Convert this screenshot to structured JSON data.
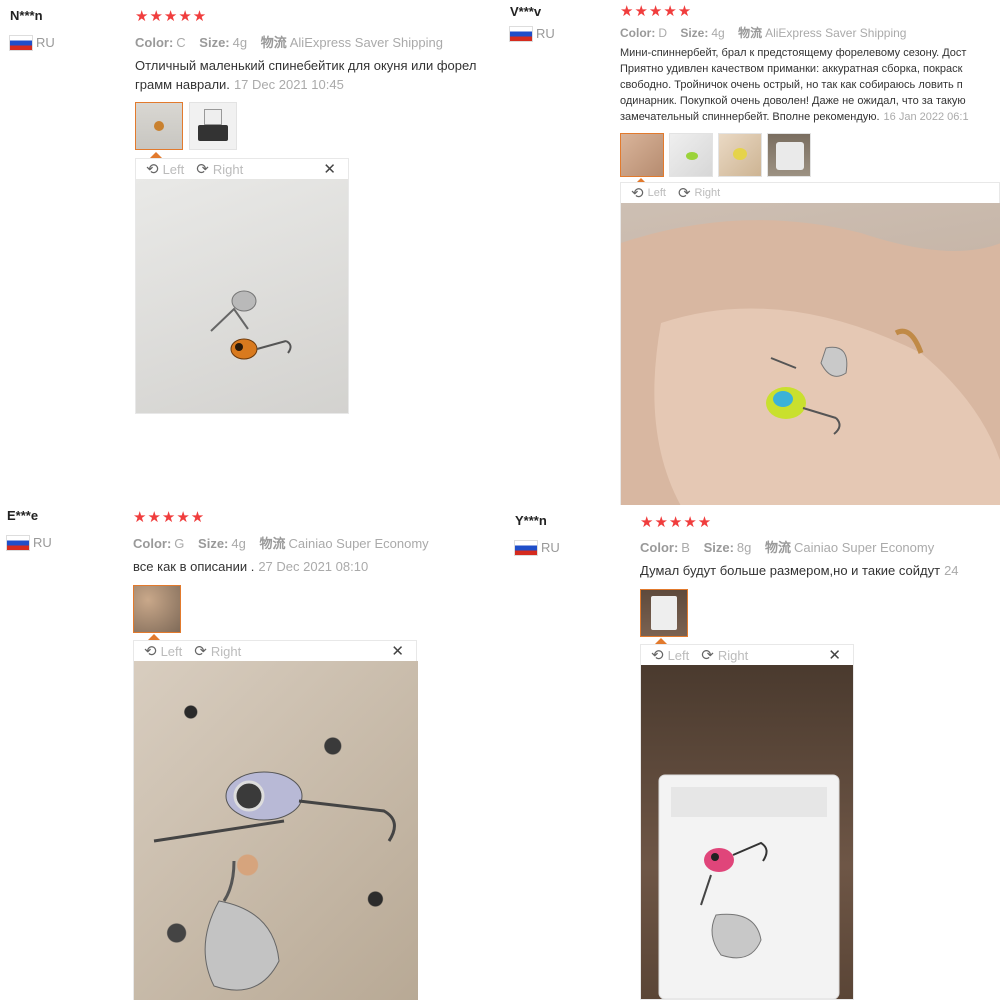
{
  "reviews": [
    {
      "user": "N***n",
      "country": "RU",
      "stars": "★★★★★",
      "color_label": "Color:",
      "color_value": "C",
      "size_label": "Size:",
      "size_value": "4g",
      "ship_label": "物流",
      "ship_value": "AliExpress Saver Shipping",
      "text_line1": "Отличный маленький спинебейтик для окуня или форел",
      "text_line2": "грамм наврали.",
      "date": "17 Dec 2021 10:45",
      "viewer": {
        "left": "Left",
        "right": "Right",
        "close": "✕"
      }
    },
    {
      "user": "V***v",
      "country": "RU",
      "stars": "★★★★★",
      "color_label": "Color:",
      "color_value": "D",
      "size_label": "Size:",
      "size_value": "4g",
      "ship_label": "物流",
      "ship_value": "AliExpress Saver Shipping",
      "text_lines": [
        "Мини-спиннербейт, брал к предстоящему форелевому сезону. Дост",
        "Приятно удивлен качеством приманки: аккуратная сборка, покраск",
        "свободно. Тройничок очень острый, но так как собираюсь ловить п",
        "одинарник. Покупкой очень доволен! Даже не ожидал, что за такую",
        "замечательный спиннербейт. Вполне рекомендую."
      ],
      "date": "16 Jan 2022 06:1",
      "viewer": {
        "left": "Left",
        "right": "Right",
        "close": "✕"
      }
    },
    {
      "user": "E***e",
      "country": "RU",
      "stars": "★★★★★",
      "color_label": "Color:",
      "color_value": "G",
      "size_label": "Size:",
      "size_value": "4g",
      "ship_label": "物流",
      "ship_value": "Cainiao Super Economy",
      "text_line1": "все как в описании .",
      "date": "27 Dec 2021 08:10",
      "viewer": {
        "left": "Left",
        "right": "Right",
        "close": "✕"
      }
    },
    {
      "user": "Y***n",
      "country": "RU",
      "stars": "★★★★★",
      "color_label": "Color:",
      "color_value": "B",
      "size_label": "Size:",
      "size_value": "8g",
      "ship_label": "物流",
      "ship_value": "Cainiao Super Economy",
      "text_line1": "Думал будут больше размером,но и такие сойдут",
      "date": "24",
      "viewer": {
        "left": "Left",
        "right": "Right",
        "close": "✕"
      }
    }
  ],
  "colors": {
    "star": "#f03d3d",
    "thumb_selected": "#e27a2d",
    "muted": "#aaaaaa"
  },
  "icons": {
    "rotate_left": "rotate-left-icon",
    "rotate_right": "rotate-right-icon",
    "close": "close-icon",
    "flag": "russia-flag-icon"
  }
}
